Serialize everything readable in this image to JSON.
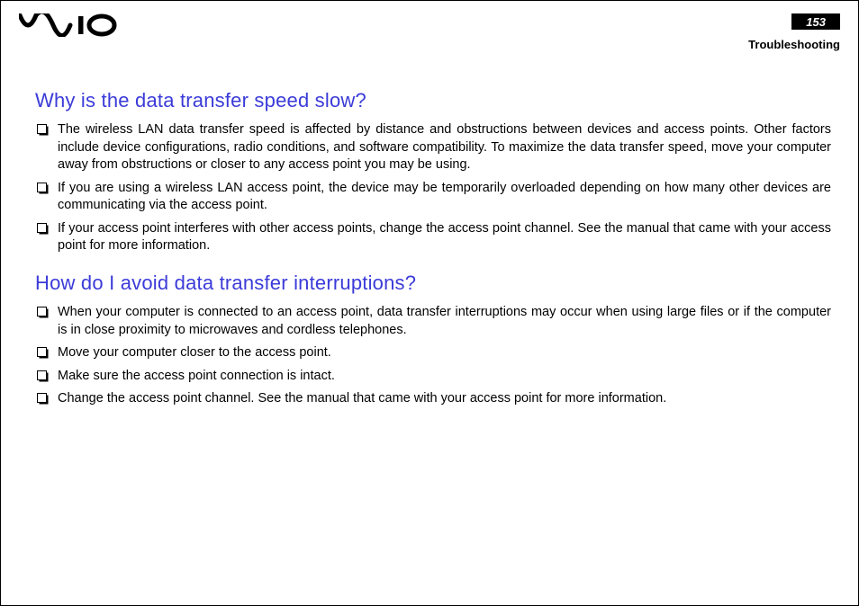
{
  "header": {
    "brand": "VAIO",
    "page_number": "153",
    "section": "Troubleshooting"
  },
  "sections": [
    {
      "id": "q1",
      "heading": "Why is the data transfer speed slow?",
      "items": [
        "The wireless LAN data transfer speed is affected by distance and obstructions between devices and access points. Other factors include device configurations, radio conditions, and software compatibility. To maximize the data transfer speed, move your computer away from obstructions or closer to any access point you may be using.",
        "If you are using a wireless LAN access point, the device may be temporarily overloaded depending on how many other devices are communicating via the access point.",
        "If your access point interferes with other access points, change the access point channel. See the manual that came with your access point for more information."
      ]
    },
    {
      "id": "q2",
      "heading": "How do I avoid data transfer interruptions?",
      "items": [
        "When your computer is connected to an access point, data transfer interruptions may occur when using large files or if the computer is in close proximity to microwaves and cordless telephones.",
        "Move your computer closer to the access point.",
        "Make sure the access point connection is intact.",
        "Change the access point channel. See the manual that came with your access point for more information."
      ]
    }
  ]
}
